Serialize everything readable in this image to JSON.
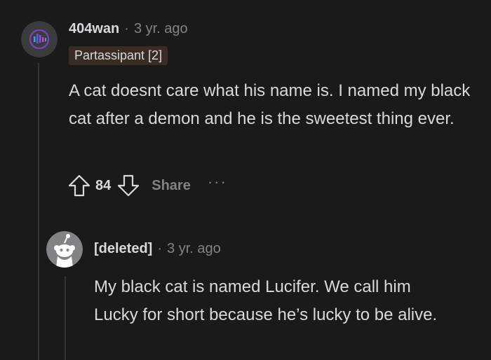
{
  "comment": {
    "author": "404wan",
    "separator": "·",
    "time": "3 yr. ago",
    "flair": "Partassipant [2]",
    "body": "A cat doesnt care what his name is. I named my black cat after a demon and he is the sweetest thing ever.",
    "score": "84",
    "share_label": "Share",
    "more_label": "···"
  },
  "reply": {
    "author": "[deleted]",
    "separator": "·",
    "time": "3 yr. ago",
    "body": "My black cat is named Lucifer. We call him Lucky for short because he’s lucky to be alive."
  },
  "colors": {
    "background": "#1a1a1b",
    "text": "#d7dadc",
    "muted": "#818384",
    "flair_bg": "#3a2b24",
    "thread_line": "#343536"
  },
  "icons": {
    "upvote": "arrow-up-outline",
    "downvote": "arrow-down-outline",
    "more": "horizontal-ellipsis"
  }
}
